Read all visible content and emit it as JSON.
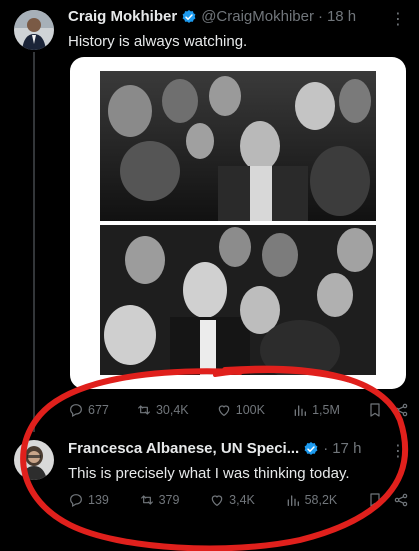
{
  "tweets": [
    {
      "name": "Craig Mokhiber",
      "handle": "@CraigMokhiber",
      "separator": "·",
      "time": "18 h",
      "more": "⋮",
      "text": "History is always watching.",
      "stats": {
        "replies": "677",
        "reposts": "30,4K",
        "likes": "100K",
        "views": "1,5M"
      }
    },
    {
      "name": "Francesca Albanese, UN Speci...",
      "handle": "",
      "separator": "·",
      "time": "17 h",
      "more": "⋮",
      "text": "This is precisely what I was thinking today.",
      "stats": {
        "replies": "139",
        "reposts": "379",
        "likes": "3,4K",
        "views": "58,2K"
      }
    }
  ],
  "icons": {
    "reply": "reply-icon",
    "repost": "repost-icon",
    "like": "heart-icon",
    "views": "views-icon",
    "bookmark": "bookmark-icon",
    "share": "share-icon",
    "verified": "verified-badge-icon"
  },
  "colors": {
    "background": "#000000",
    "text": "#e7e9ea",
    "muted": "#71767b",
    "verified": "#1d9bf0",
    "annotation": "#e0201c"
  }
}
